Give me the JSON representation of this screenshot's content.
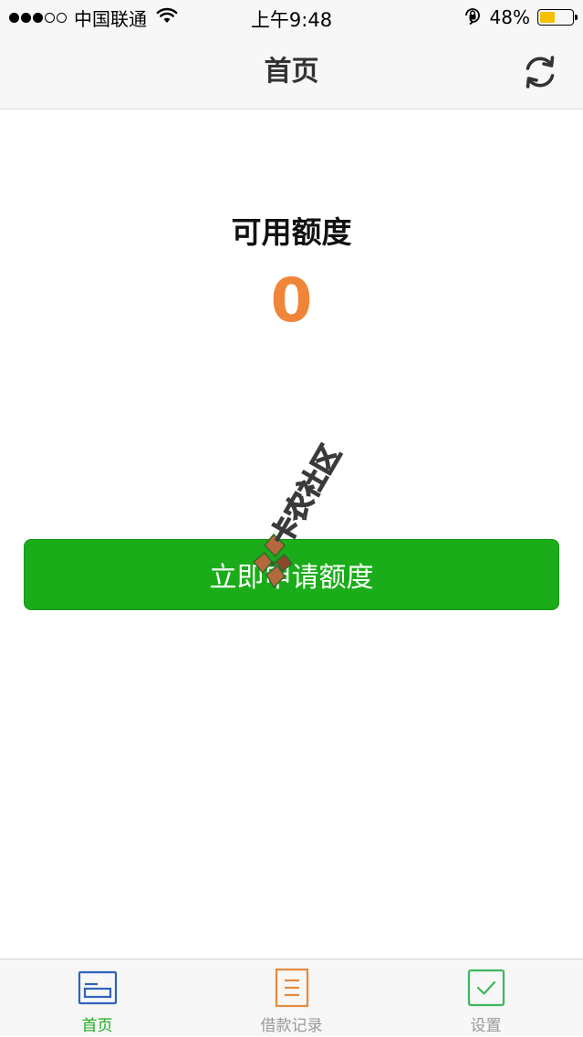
{
  "status_bar": {
    "carrier": "中国联通",
    "time": "上午9:48",
    "battery_percent": "48%",
    "battery_level": 0.48,
    "battery_color": "#f5c000",
    "signal_strength": 3,
    "signal_max": 5
  },
  "nav": {
    "title": "首页",
    "refresh_icon": "refresh-icon"
  },
  "credit": {
    "label": "可用额度",
    "value": "0",
    "value_color": "#f0853a"
  },
  "apply_button": {
    "label": "立即申请额度",
    "color": "#1aad19"
  },
  "watermark": {
    "text": "卡农社区"
  },
  "tabs": [
    {
      "label": "首页",
      "icon": "home-icon",
      "color": "#1aad19",
      "icon_color": "#2f63b8",
      "active": true
    },
    {
      "label": "借款记录",
      "icon": "document-list-icon",
      "color": "#999999",
      "icon_color": "#e58a3a",
      "active": false
    },
    {
      "label": "设置",
      "icon": "checkbox-check-icon",
      "color": "#999999",
      "icon_color": "#3cb65c",
      "active": false
    }
  ]
}
